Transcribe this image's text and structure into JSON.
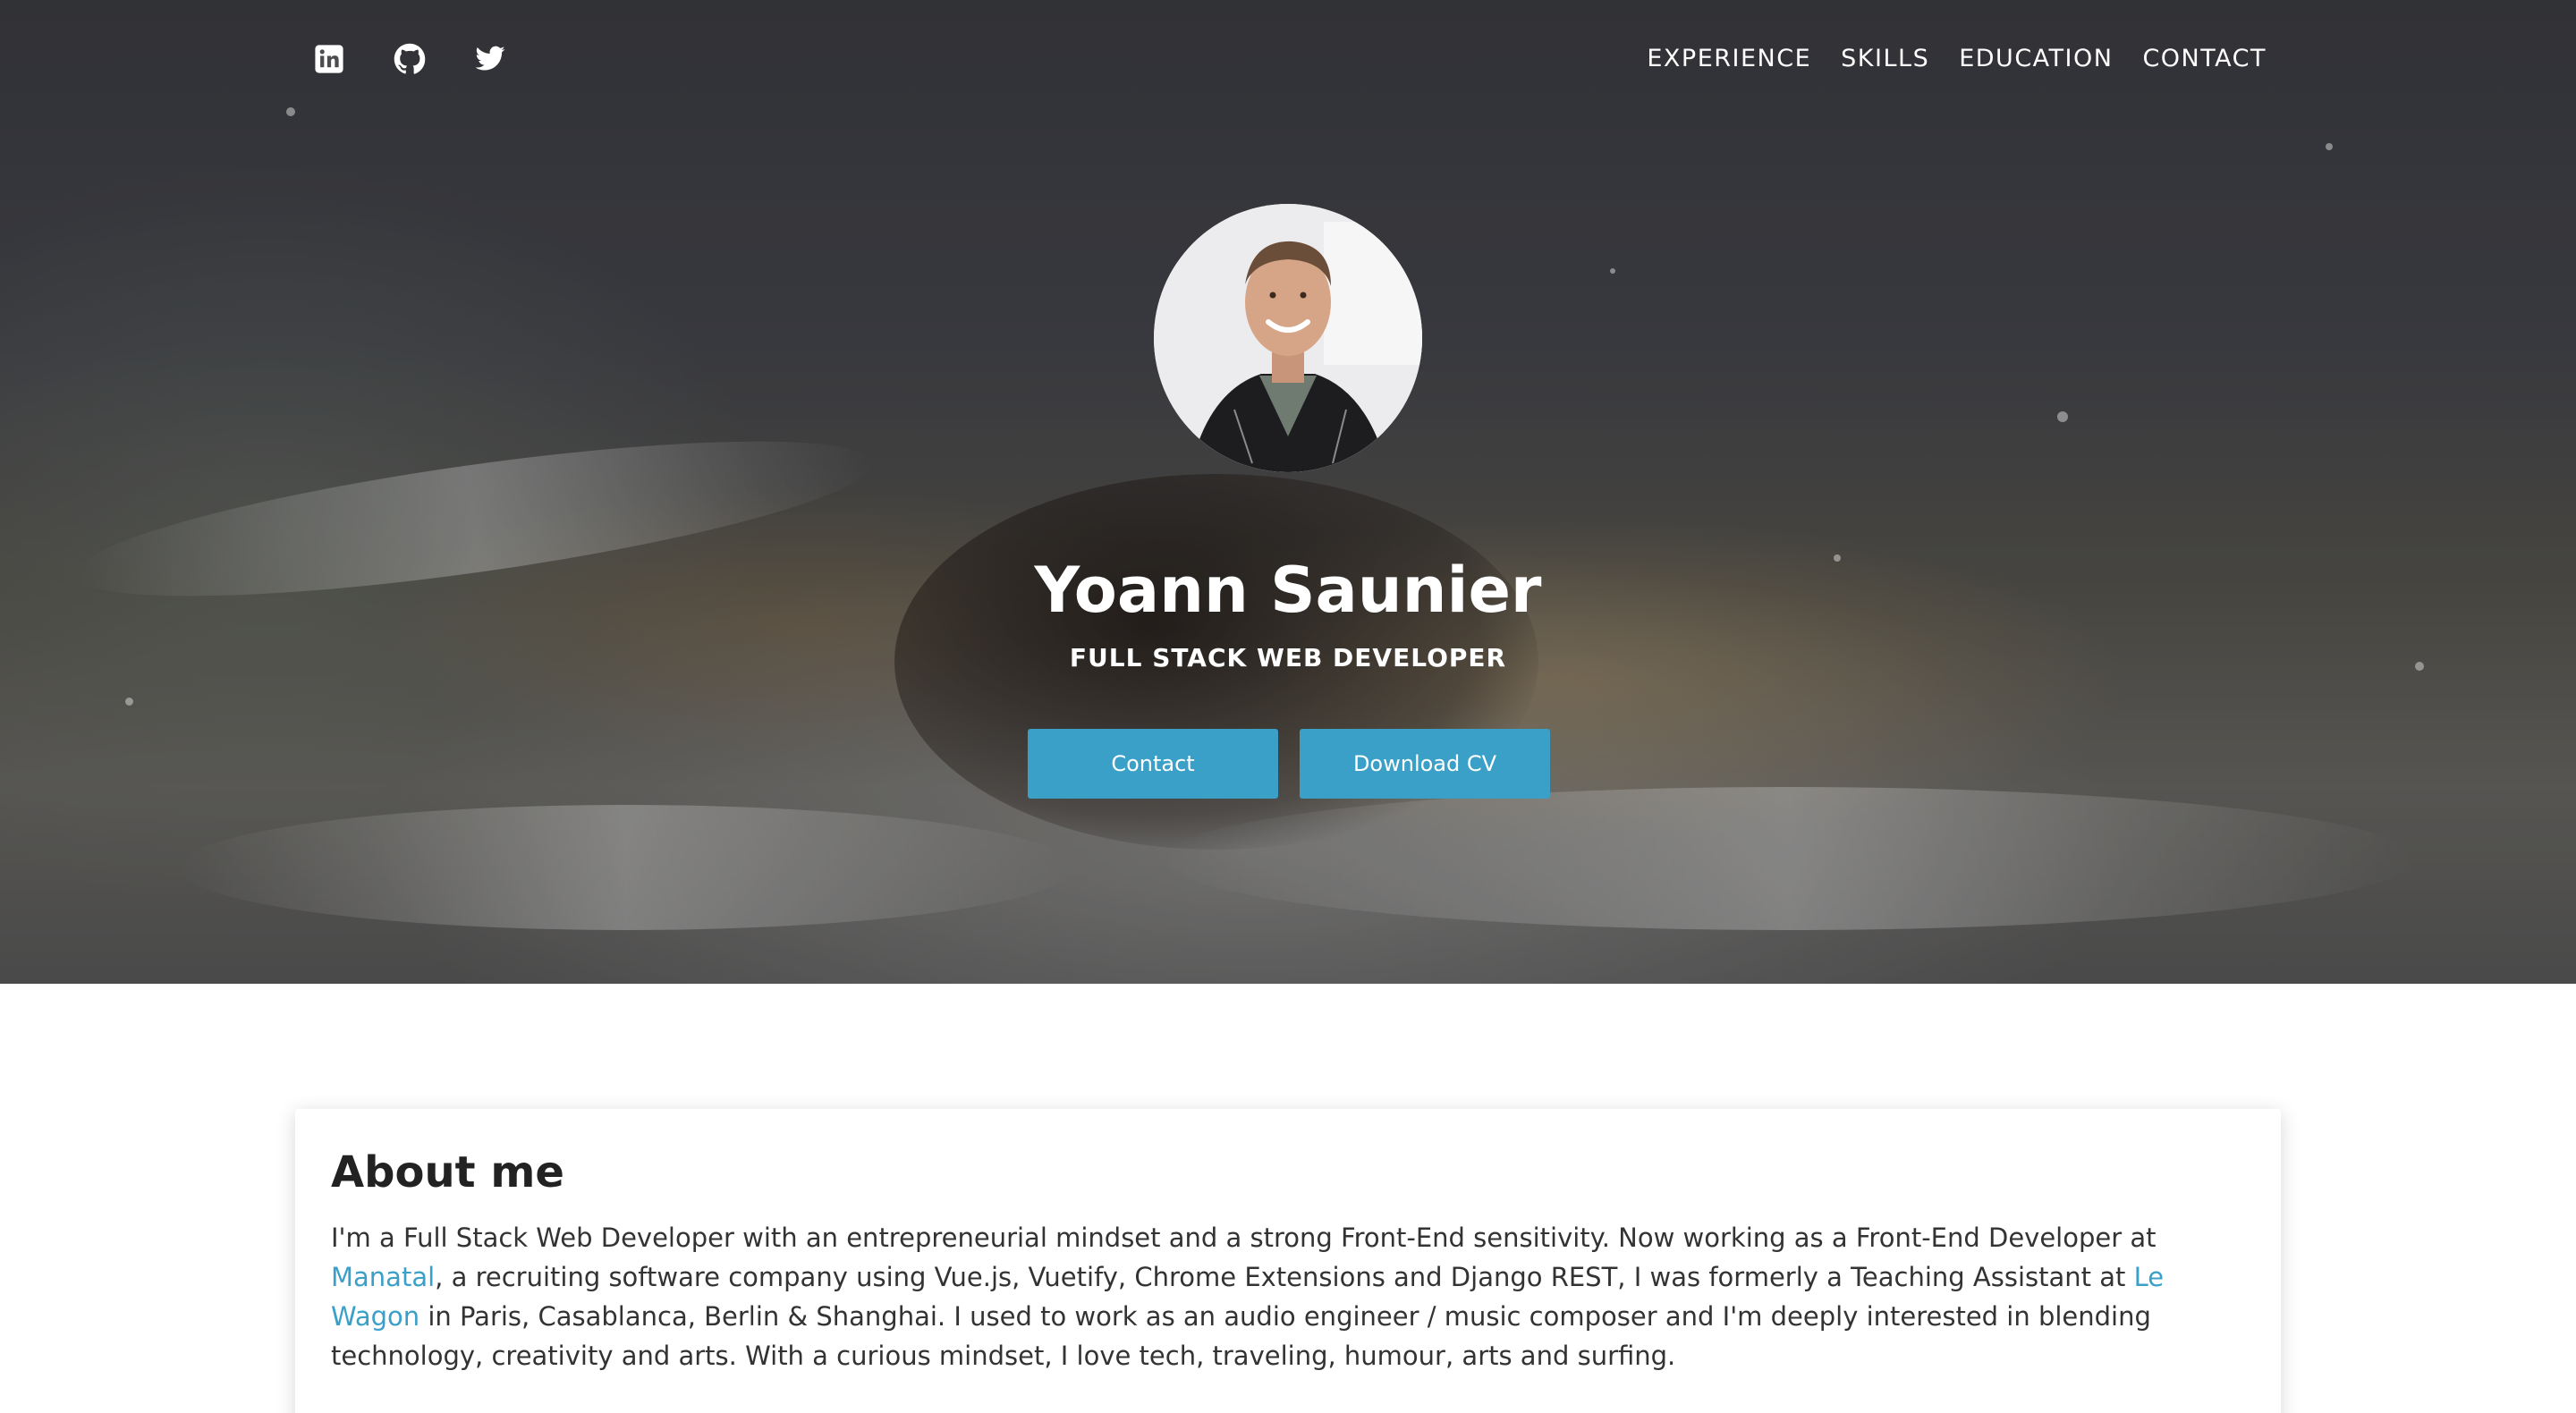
{
  "nav": {
    "items": [
      {
        "label": "EXPERIENCE"
      },
      {
        "label": "SKILLS"
      },
      {
        "label": "EDUCATION"
      },
      {
        "label": "CONTACT"
      }
    ]
  },
  "social": [
    "linkedin-icon",
    "github-icon",
    "twitter-icon"
  ],
  "hero": {
    "name": "Yoann Saunier",
    "title": "FULL STACK WEB DEVELOPER",
    "contact_label": "Contact",
    "cv_label": "Download CV"
  },
  "about": {
    "heading": "About me",
    "text_1": "I'm a Full Stack Web Developer with an entrepreneurial mindset and a strong Front-End sensitivity. Now working as a Front-End Developer at ",
    "link_1": "Manatal",
    "text_2": ", a recruiting software company using Vue.js, Vuetify, Chrome Extensions and Django REST, I was formerly a Teaching Assistant at ",
    "link_2": "Le Wagon",
    "text_3": " in Paris, Casablanca, Berlin & Shanghai. I used to work as an audio engineer / music composer and I'm deeply interested in blending technology, creativity and arts. With a curious mindset, I love tech, traveling, humour, arts and surfing."
  },
  "colors": {
    "accent": "#3aa0c8",
    "text": "#222222"
  }
}
